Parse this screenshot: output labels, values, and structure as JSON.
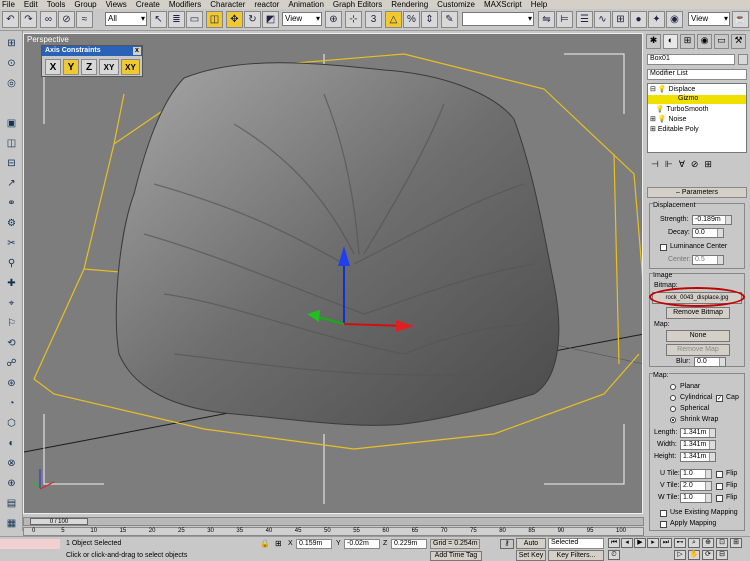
{
  "menu": [
    "File",
    "Edit",
    "Tools",
    "Group",
    "Views",
    "Create",
    "Modifiers",
    "Character",
    "reactor",
    "Animation",
    "Graph Editors",
    "Rendering",
    "Customize",
    "MAXScript",
    "Help"
  ],
  "toolbar": {
    "selection_filter": "All",
    "ref_coord": "View",
    "named_sets": "",
    "view_right": "View"
  },
  "viewport": {
    "label": "Perspective"
  },
  "axis_constraints": {
    "title": "Axis Constraints",
    "close": "x",
    "buttons": [
      "X",
      "Y",
      "Z",
      "XY",
      "XY"
    ]
  },
  "cmd": {
    "object_name": "Box01",
    "modifier_list": "Modifier List",
    "stack": [
      {
        "label": "Displace",
        "expander": "⊟",
        "lit": true
      },
      {
        "label": "Gizmo",
        "expander": "",
        "lit": true,
        "highlight": true
      },
      {
        "label": "TurboSmooth",
        "expander": "",
        "lit": false
      },
      {
        "label": "Noise",
        "expander": "⊞",
        "lit": true
      },
      {
        "label": "Editable Poly",
        "expander": "⊞",
        "lit": false
      }
    ],
    "parameters": "Parameters",
    "displacement": {
      "title": "Displacement",
      "strength_label": "Strength:",
      "strength": "-0.189m",
      "decay_label": "Decay:",
      "decay": "0.0",
      "luminance": "Luminance Center",
      "center_label": "Center:",
      "center": "0.5"
    },
    "image": {
      "title": "Image",
      "bitmap_label": "Bitmap:",
      "bitmap": "rock_0043_displace.jpg",
      "remove_bitmap": "Remove Bitmap",
      "map_label": "Map:",
      "map": "None",
      "remove_map": "Remove Map",
      "blur_label": "Blur:",
      "blur": "0.0"
    },
    "map": {
      "title": "Map:",
      "planar": "Planar",
      "cylindrical": "Cylindrical",
      "cap": "Cap",
      "spherical": "Spherical",
      "shrink_wrap": "Shrink Wrap",
      "length_label": "Length:",
      "length": "1.341m",
      "width_label": "Width:",
      "width": "1.341m",
      "height_label": "Height:",
      "height": "1.341m",
      "utile_label": "U Tile:",
      "utile": "1.0",
      "vtile_label": "V Tile:",
      "vtile": "2.0",
      "wtile_label": "W Tile:",
      "wtile": "1.0",
      "flip": "Flip",
      "use_existing": "Use Existing Mapping",
      "apply_mapping": "Apply Mapping"
    }
  },
  "timeline": {
    "slider": "0 / 100",
    "ticks": [
      "0",
      "5",
      "10",
      "15",
      "20",
      "25",
      "30",
      "35",
      "40",
      "45",
      "50",
      "55",
      "60",
      "65",
      "70",
      "75",
      "80",
      "85",
      "90",
      "95",
      "100"
    ]
  },
  "status": {
    "selected": "1 Object Selected",
    "prompt": "Click or click-and-drag to select objects",
    "x_label": "X",
    "x": "0.159m",
    "y_label": "Y",
    "y": "-0.02m",
    "z_label": "Z",
    "z": "0.229m",
    "grid": "Grid = 0.254m",
    "add_time_tag": "Add Time Tag",
    "auto_key": "Auto Key",
    "set_key": "Set Key",
    "key_mode": "Selected",
    "key_filters": "Key Filters..."
  },
  "colors": {
    "viewport_bg": "#7d7d7d",
    "highlight": "#f0c830",
    "gizmo": "#e8c020",
    "accent_red": "#c00000"
  }
}
